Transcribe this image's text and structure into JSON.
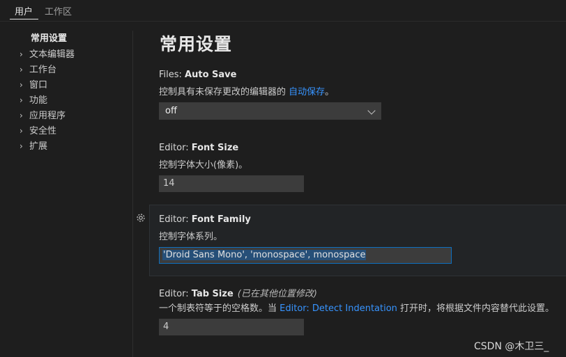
{
  "tabs": [
    {
      "label": "用户",
      "active": true
    },
    {
      "label": "工作区",
      "active": false
    }
  ],
  "toc": [
    {
      "label": "常用设置",
      "active": true
    },
    {
      "label": "文本编辑器"
    },
    {
      "label": "工作台"
    },
    {
      "label": "窗口"
    },
    {
      "label": "功能"
    },
    {
      "label": "应用程序"
    },
    {
      "label": "安全性"
    },
    {
      "label": "扩展"
    }
  ],
  "page_title": "常用设置",
  "settings": {
    "auto_save": {
      "category": "Files: ",
      "key": "Auto Save",
      "desc_prefix": "控制具有未保存更改的编辑器的 ",
      "desc_link": "自动保存",
      "desc_suffix": "。",
      "value": "off"
    },
    "font_size": {
      "category": "Editor: ",
      "key": "Font Size",
      "desc": "控制字体大小(像素)。",
      "value": "14"
    },
    "font_family": {
      "category": "Editor: ",
      "key": "Font Family",
      "desc": "控制字体系列。",
      "value": "'Droid Sans Mono', 'monospace', monospace"
    },
    "tab_size": {
      "category": "Editor: ",
      "key": "Tab Size",
      "modified": "(已在其他位置修改)",
      "desc_prefix": "一个制表符等于的空格数。当 ",
      "desc_link": "Editor: Detect Indentation",
      "desc_suffix": " 打开时，将根据文件内容替代此设置。",
      "value": "4"
    }
  },
  "watermark": "CSDN @木卫三_",
  "colors": {
    "background": "#1e1e1e",
    "link": "#3794ff",
    "focus_border": "#0e70c0",
    "selection": "#264f78"
  }
}
